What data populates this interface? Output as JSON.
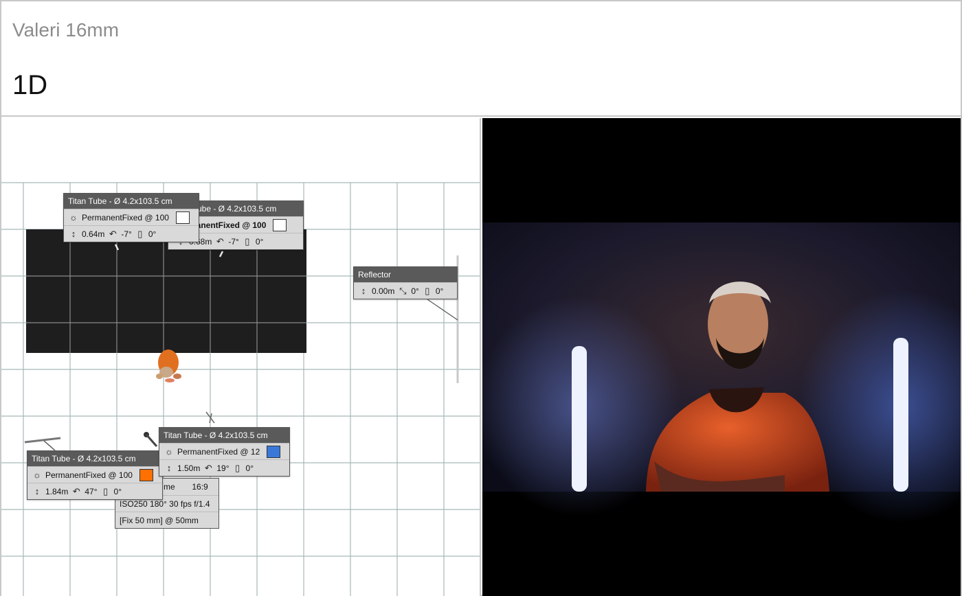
{
  "header": {
    "lens": "Valeri 16mm",
    "shot": "1D"
  },
  "colors": {
    "grid_line": "#a8b8b8",
    "backdrop": "#1e1e1e",
    "panel_head": "#5a5a5a",
    "panel_body": "#d9d9d9",
    "swatch_white": "#ffffff",
    "swatch_orange": "#ff7000",
    "swatch_blue": "#3a78d8"
  },
  "plan": {
    "lights": [
      {
        "title": "Titan Tube - Ø 4.2x103.5 cm",
        "mode": "PermanentFixed @ 100",
        "swatch": "#ffffff",
        "height": "0.64m",
        "tilt": "-7°",
        "roll": "0°"
      },
      {
        "title": "ube - Ø 4.2x103.5 cm",
        "mode": "manentFixed @ 100",
        "swatch": "#ffffff",
        "height": "0.68m",
        "tilt": "-7°",
        "roll": "0°"
      },
      {
        "title": "Titan Tube - Ø 4.2x103.5 cm",
        "mode": "PermanentFixed @ 12",
        "swatch": "#3a78d8",
        "height": "1.50m",
        "tilt": "19°",
        "roll": "0°"
      },
      {
        "title": "Titan Tube - Ø 4.2x103.5 cm",
        "mode": "PermanentFixed @ 100",
        "swatch": "#ff7000",
        "height": "1.84m",
        "tilt": "47°",
        "roll": "0°"
      }
    ],
    "reflector": {
      "title": "Reflector",
      "height": "0.00m",
      "angle": "0°",
      "roll": "0°"
    },
    "camera": {
      "frame_label": "me",
      "aspect": "16:9",
      "settings": "ISO250  180°  30 fps  f/1.4",
      "lens": "[Fix 50 mm] @ 50mm"
    }
  },
  "icons": {
    "light": "sun-icon",
    "height": "height-arrows-icon",
    "tilt": "tilt-icon",
    "roll": "roll-icon",
    "pan": "pan-icon"
  }
}
